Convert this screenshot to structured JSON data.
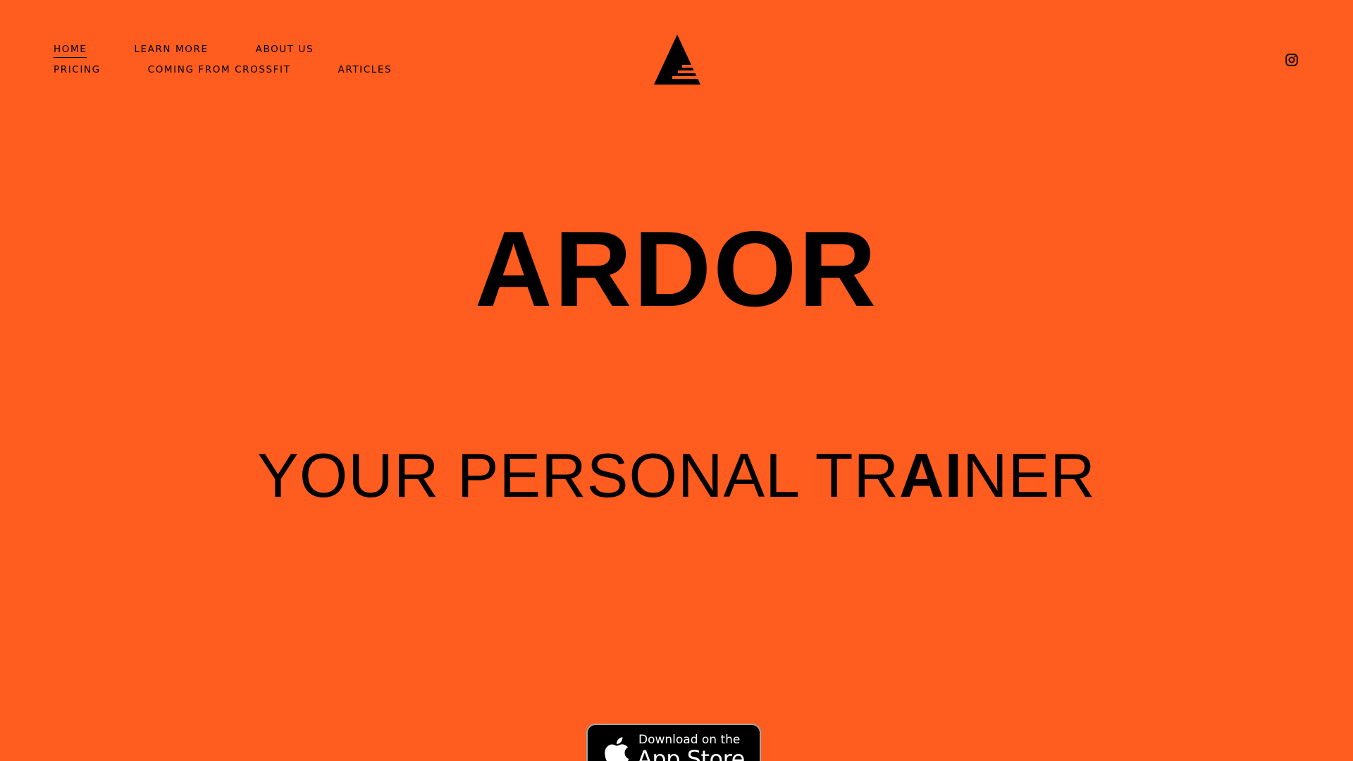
{
  "nav": {
    "items": [
      {
        "label": "HOME",
        "active": true
      },
      {
        "label": "LEARN MORE",
        "active": false
      },
      {
        "label": "ABOUT US",
        "active": false
      },
      {
        "label": "PRICING",
        "active": false
      },
      {
        "label": "COMING FROM CROSSFIT",
        "active": false
      },
      {
        "label": "ARTICLES",
        "active": false
      }
    ]
  },
  "header": {
    "logo_icon": "stepped-triangle-logo-icon",
    "social_icon": "instagram-icon"
  },
  "hero": {
    "title": "ARDOR",
    "tagline_part1": "YOUR PERSONAL TR",
    "tagline_bold": "AI",
    "tagline_part2": "NER"
  },
  "app_store": {
    "line1": "Download on the",
    "line2": "App Store",
    "icon": "apple-icon"
  },
  "colors": {
    "background": "#FF5C1F",
    "text": "#000000",
    "badge_bg": "#000000",
    "badge_text": "#FFFFFF"
  }
}
